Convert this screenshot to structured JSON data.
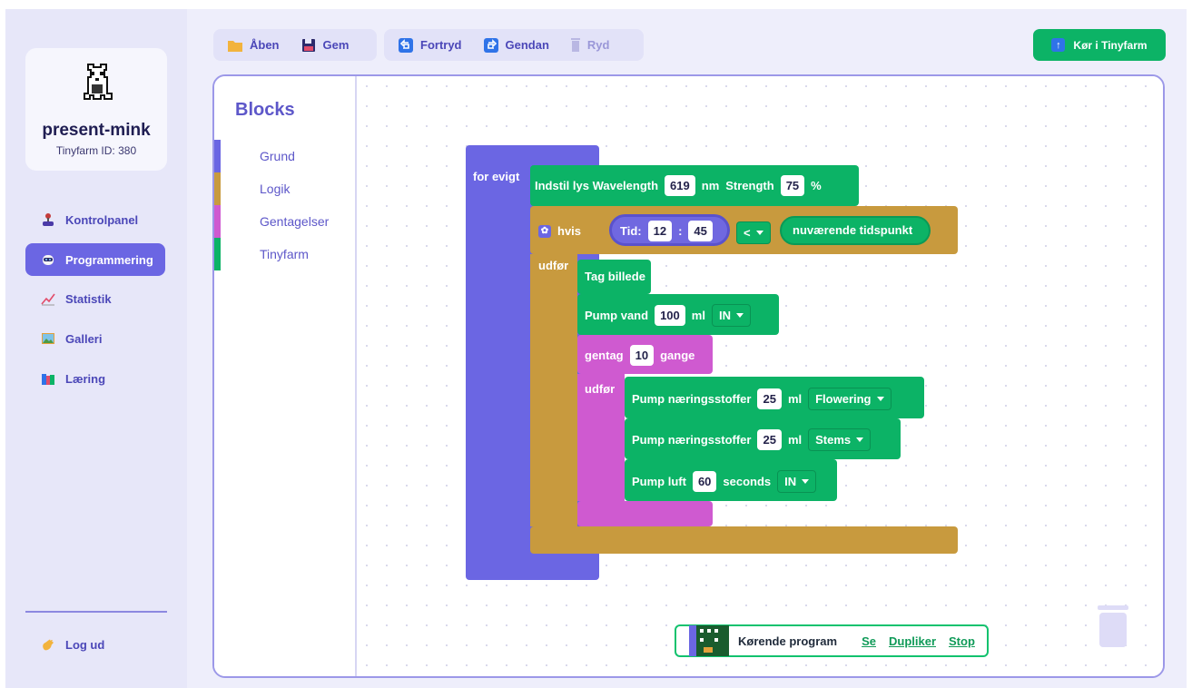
{
  "profile": {
    "name": "present-mink",
    "id_text": "Tinyfarm ID: 380"
  },
  "nav": [
    {
      "label": "Kontrolpanel",
      "icon": "joystick-icon"
    },
    {
      "label": "Programmering",
      "icon": "robot-icon",
      "active": true
    },
    {
      "label": "Statistik",
      "icon": "chart-icon"
    },
    {
      "label": "Galleri",
      "icon": "picture-icon"
    },
    {
      "label": "Læring",
      "icon": "books-icon"
    }
  ],
  "logout": {
    "label": "Log ud",
    "icon": "waving-hand-icon"
  },
  "toolbar": {
    "open": "Åben",
    "save": "Gem",
    "undo": "Fortryd",
    "redo": "Gendan",
    "clear": "Ryd",
    "run": "Kør i Tinyfarm"
  },
  "toolbox": {
    "title": "Blocks",
    "categories": [
      {
        "label": "Grund",
        "color": "#6a66e3"
      },
      {
        "label": "Logik",
        "color": "#c89a3e"
      },
      {
        "label": "Gentagelser",
        "color": "#cf5ad0"
      },
      {
        "label": "Tinyfarm",
        "color": "#0cb366"
      }
    ]
  },
  "blocks": {
    "forever": "for evigt",
    "light": {
      "prefix": "Indstil lys Wavelength",
      "wavelength": "619",
      "nm": "nm",
      "strength_label": "Strength",
      "strength": "75",
      "pct": "%"
    },
    "if": {
      "label": "hvis",
      "time_label": "Tid:",
      "hour": "12",
      "colon": ":",
      "minute": "45",
      "operator": "<",
      "now": "nuværende tidspunkt",
      "do": "udfør"
    },
    "photo": "Tag billede",
    "pump_water": {
      "label": "Pump vand",
      "amount": "100",
      "unit": "ml",
      "dir": "IN"
    },
    "repeat": {
      "label": "gentag",
      "count": "10",
      "times": "gange",
      "do": "udfør"
    },
    "nutrient1": {
      "label": "Pump næringsstoffer",
      "amount": "25",
      "unit": "ml",
      "type": "Flowering"
    },
    "nutrient2": {
      "label": "Pump næringsstoffer",
      "amount": "25",
      "unit": "ml",
      "type": "Stems"
    },
    "air": {
      "label": "Pump luft",
      "amount": "60",
      "unit": "seconds",
      "dir": "IN"
    }
  },
  "running": {
    "label": "Kørende program",
    "see": "Se",
    "duplicate": "Dupliker",
    "stop": "Stop"
  },
  "colors": {
    "accent": "#6b66e3",
    "logic": "#c89a3e",
    "loop": "#cf5ad0",
    "farm": "#0cb366",
    "time": "#7068e0"
  }
}
